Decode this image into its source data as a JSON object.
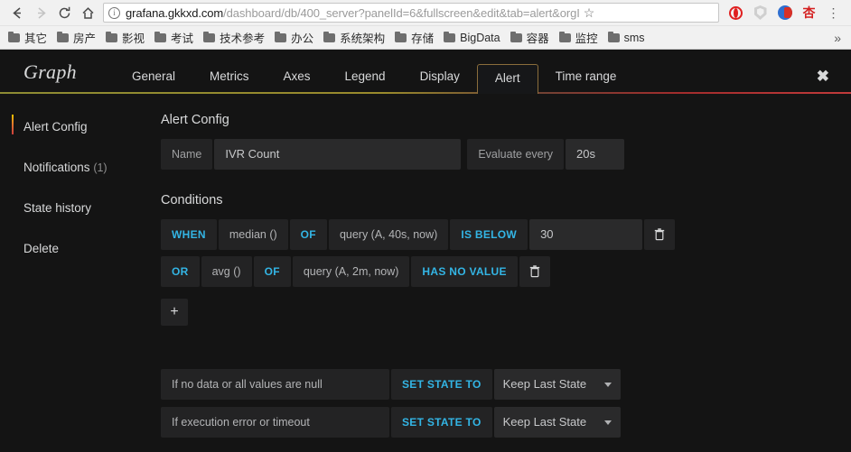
{
  "browser": {
    "nav": {
      "back_icon": "arrow-left-icon",
      "forward_icon": "arrow-right-icon",
      "reload_icon": "reload-icon",
      "home_icon": "home-icon"
    },
    "omnibox": {
      "info_icon": "info-icon",
      "host": "grafana.gkkxd.com",
      "path": "/dashboard/db/400_server?panelId=6&fullscreen&edit&tab=alert&orgI",
      "star_icon": "bookmark-star-icon"
    },
    "extensions": [
      {
        "name": "opera-extension-icon"
      },
      {
        "name": "shield-extension-icon"
      },
      {
        "name": "translate-extension-icon"
      },
      {
        "name": "xing-extension-icon",
        "label": "杏"
      }
    ],
    "menu_icon": "kebab-menu-icon",
    "bookmarks": [
      {
        "label": "其它"
      },
      {
        "label": "房产"
      },
      {
        "label": "影视"
      },
      {
        "label": "考试"
      },
      {
        "label": "技术参考"
      },
      {
        "label": "办公"
      },
      {
        "label": "系统架构"
      },
      {
        "label": "存储"
      },
      {
        "label": "BigData"
      },
      {
        "label": "容器"
      },
      {
        "label": "监控"
      },
      {
        "label": "sms"
      }
    ],
    "bookmarks_overflow": "»"
  },
  "editor": {
    "panel_title": "Graph",
    "tabs": [
      {
        "label": "General",
        "active": false
      },
      {
        "label": "Metrics",
        "active": false
      },
      {
        "label": "Axes",
        "active": false
      },
      {
        "label": "Legend",
        "active": false
      },
      {
        "label": "Display",
        "active": false
      },
      {
        "label": "Alert",
        "active": true
      },
      {
        "label": "Time range",
        "active": false
      }
    ],
    "close_label": "✖",
    "sidebar": {
      "items": [
        {
          "label": "Alert Config",
          "count": "",
          "active": true
        },
        {
          "label": "Notifications",
          "count": "(1)",
          "active": false
        },
        {
          "label": "State history",
          "count": "",
          "active": false
        },
        {
          "label": "Delete",
          "count": "",
          "active": false
        }
      ]
    },
    "alert_config": {
      "section_title": "Alert Config",
      "name_label": "Name",
      "name_value": "IVR Count",
      "evaluate_label": "Evaluate every",
      "evaluate_value": "20s"
    },
    "conditions": {
      "section_title": "Conditions",
      "rows": [
        {
          "operator": "WHEN",
          "reducer": "median ()",
          "of": "OF",
          "query": "query (A, 40s, now)",
          "evaluator": "IS BELOW",
          "threshold": "30",
          "has_threshold": true,
          "delete_icon": "trash-icon"
        },
        {
          "operator": "OR",
          "reducer": "avg ()",
          "of": "OF",
          "query": "query (A, 2m, now)",
          "evaluator": "HAS NO VALUE",
          "threshold": "",
          "has_threshold": false,
          "delete_icon": "trash-icon"
        }
      ],
      "add_label": "+"
    },
    "no_data_handling": [
      {
        "description": "If no data or all values are null",
        "set_state_label": "SET STATE TO",
        "state_value": "Keep Last State"
      },
      {
        "description": "If execution error or timeout",
        "set_state_label": "SET STATE TO",
        "state_value": "Keep Last State"
      }
    ]
  },
  "colors": {
    "accent_blue": "#33b5e5",
    "accent_orange": "#8a6d3b",
    "panel_bg": "#141414",
    "input_bg": "#2a2a2b",
    "label_bg": "#232324"
  }
}
